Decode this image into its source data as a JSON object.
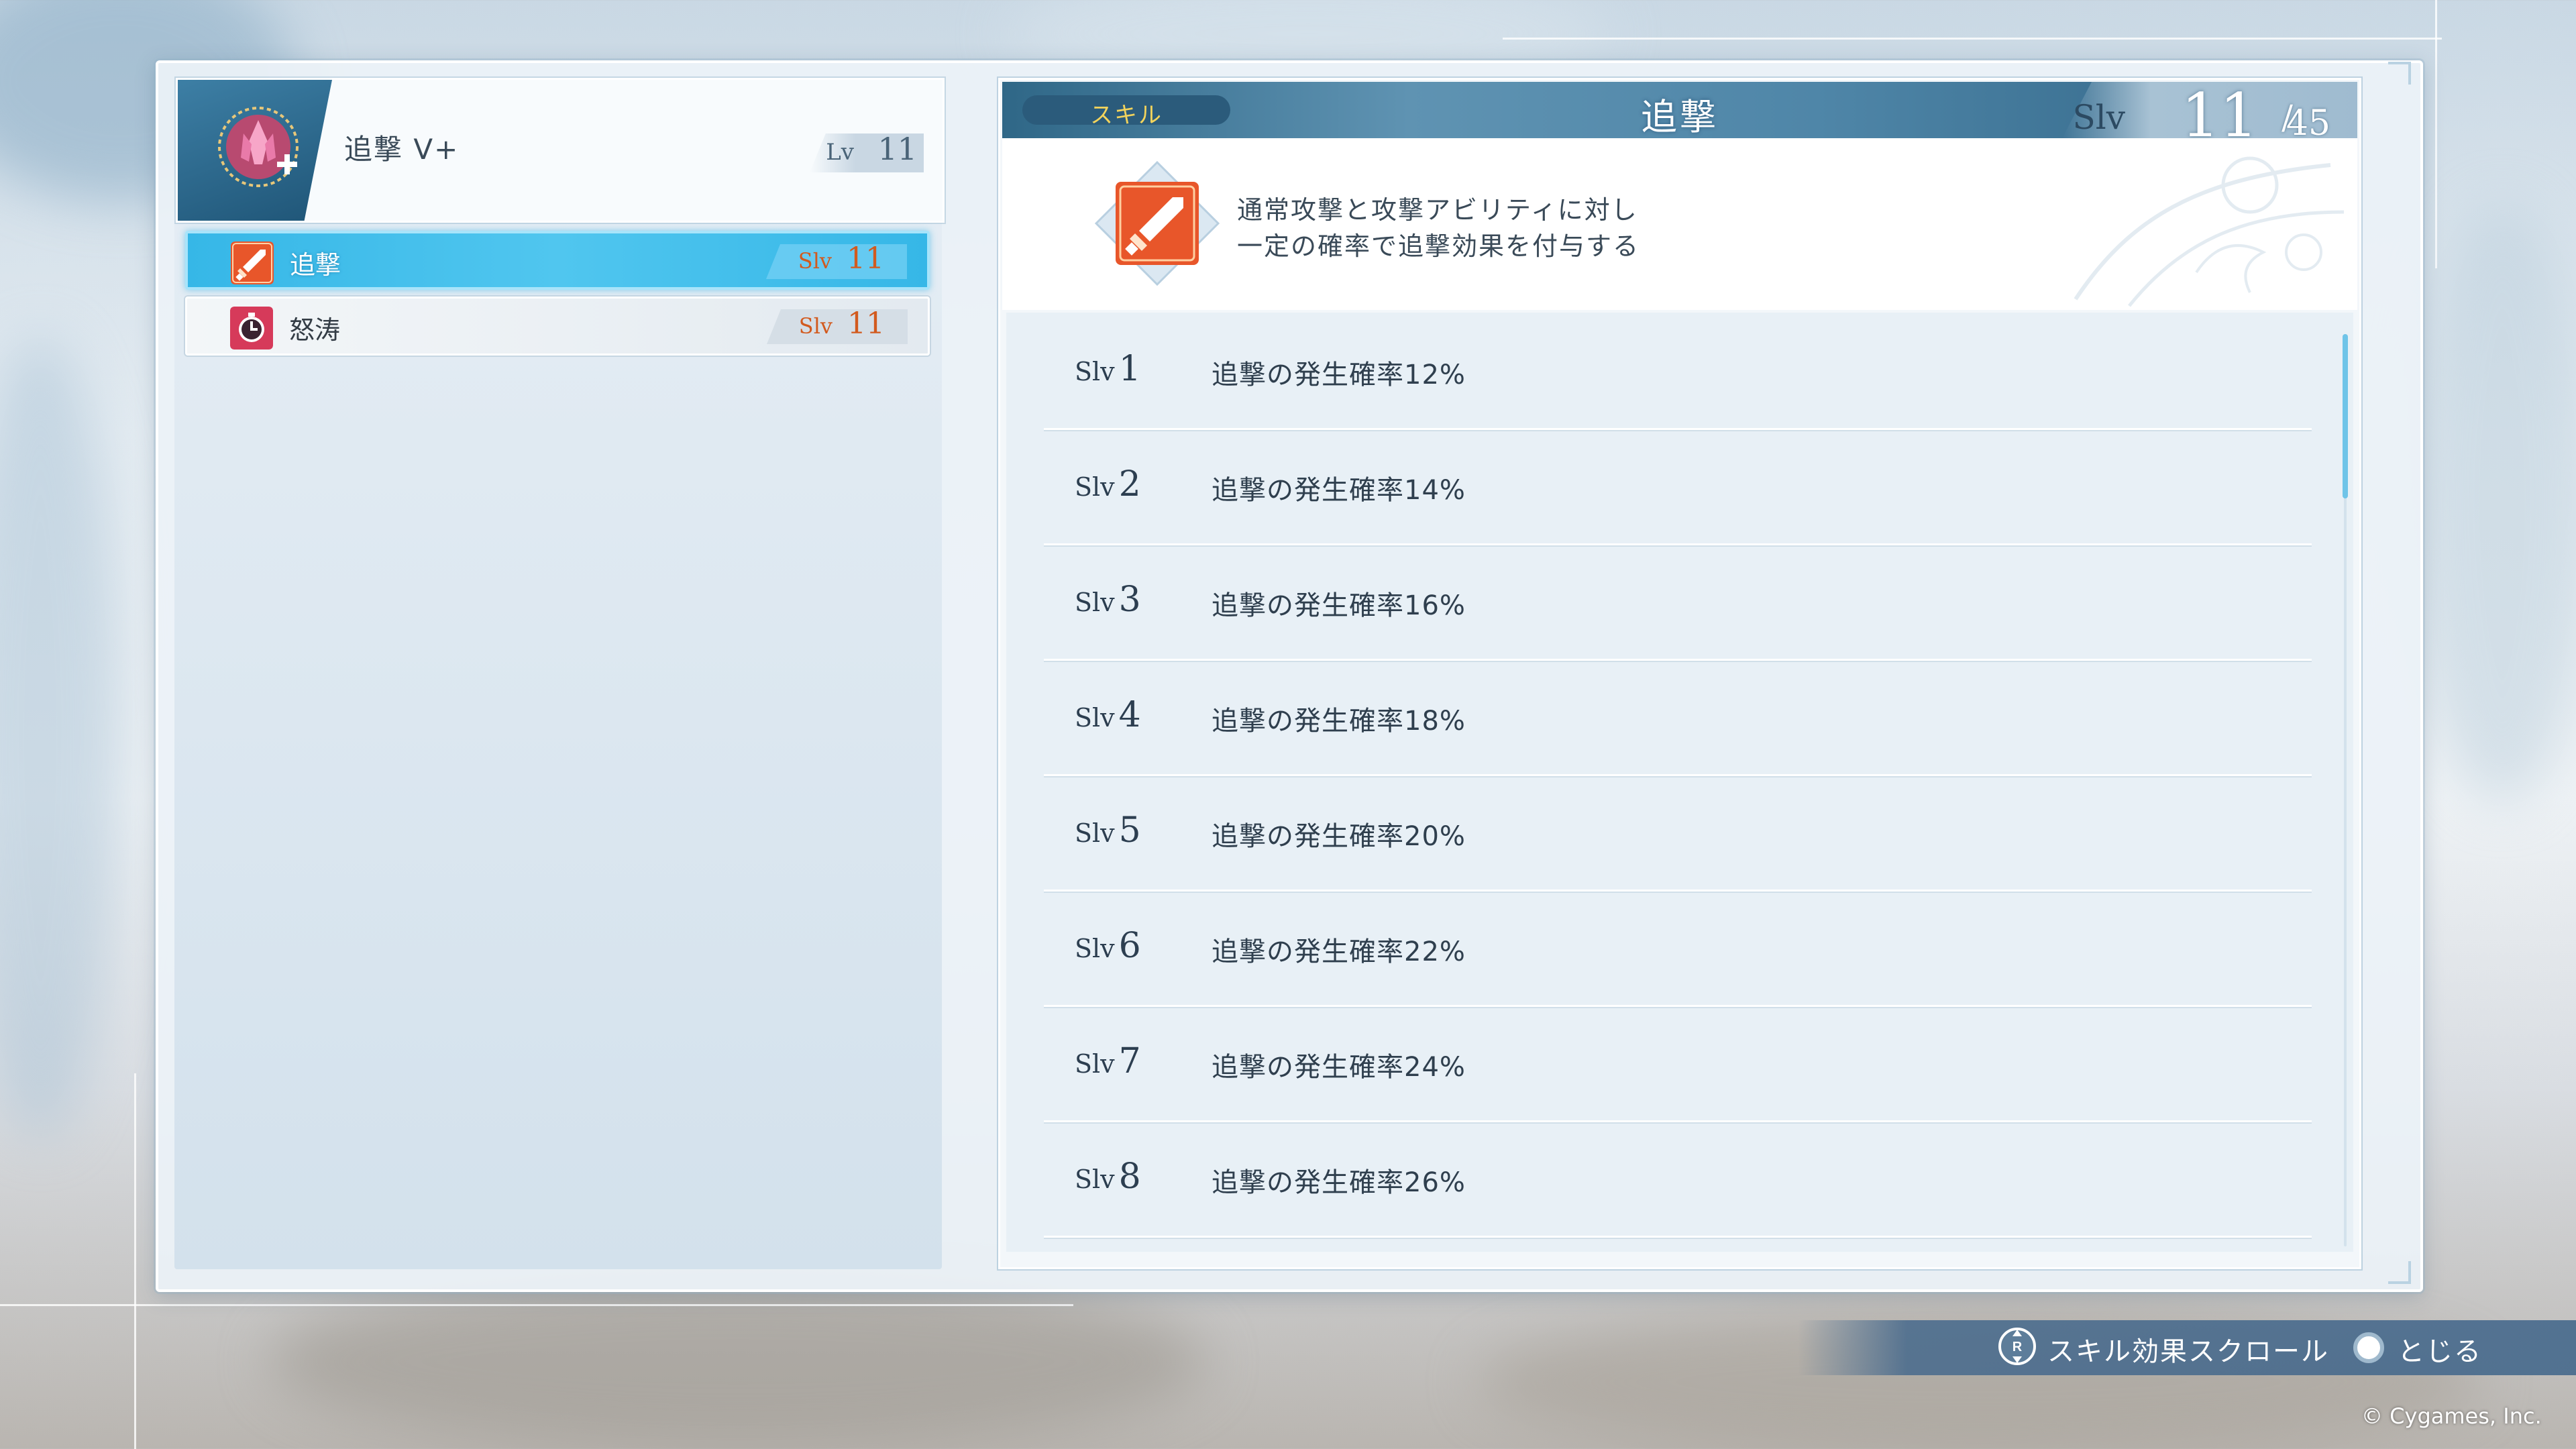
{
  "colors": {
    "accent_blue": "#36b7e7",
    "header_blue": "#3b7597",
    "category_yellow": "#f2d35c",
    "slv_orange": "#d25a1e"
  },
  "character": {
    "name": "追撃 V+",
    "level_label": "Lv",
    "level_value": "11",
    "icon": "crystal-plus-emblem-icon"
  },
  "skill_list": [
    {
      "name": "追撃",
      "slv_label": "Slv",
      "slv_value": "11",
      "icon": "sword-icon",
      "selected": true
    },
    {
      "name": "怒涛",
      "slv_label": "Slv",
      "slv_value": "11",
      "icon": "clock-icon",
      "selected": false
    }
  ],
  "detail": {
    "category": "スキル",
    "title": "追撃",
    "slv_label": "Slv",
    "slv_current": "11",
    "slv_max_sep": "/",
    "slv_max": "45",
    "icon": "sword-icon",
    "description_lines": [
      "通常攻撃と攻撃アビリティに対し",
      "一定の確率で追撃効果を付与する"
    ],
    "levels": [
      {
        "label": "Slv",
        "level": "1",
        "effect": "追撃の発生確率12%"
      },
      {
        "label": "Slv",
        "level": "2",
        "effect": "追撃の発生確率14%"
      },
      {
        "label": "Slv",
        "level": "3",
        "effect": "追撃の発生確率16%"
      },
      {
        "label": "Slv",
        "level": "4",
        "effect": "追撃の発生確率18%"
      },
      {
        "label": "Slv",
        "level": "5",
        "effect": "追撃の発生確率20%"
      },
      {
        "label": "Slv",
        "level": "6",
        "effect": "追撃の発生確率22%"
      },
      {
        "label": "Slv",
        "level": "7",
        "effect": "追撃の発生確率24%"
      },
      {
        "label": "Slv",
        "level": "8",
        "effect": "追撃の発生確率26%"
      }
    ],
    "scroll_position": 0.18
  },
  "controls": {
    "scroll_hint": "スキル効果スクロール",
    "scroll_icon": "right-stick-icon",
    "close_hint": "とじる",
    "close_icon": "circle-button-icon"
  },
  "footer": {
    "copyright": "© Cygames, Inc."
  }
}
